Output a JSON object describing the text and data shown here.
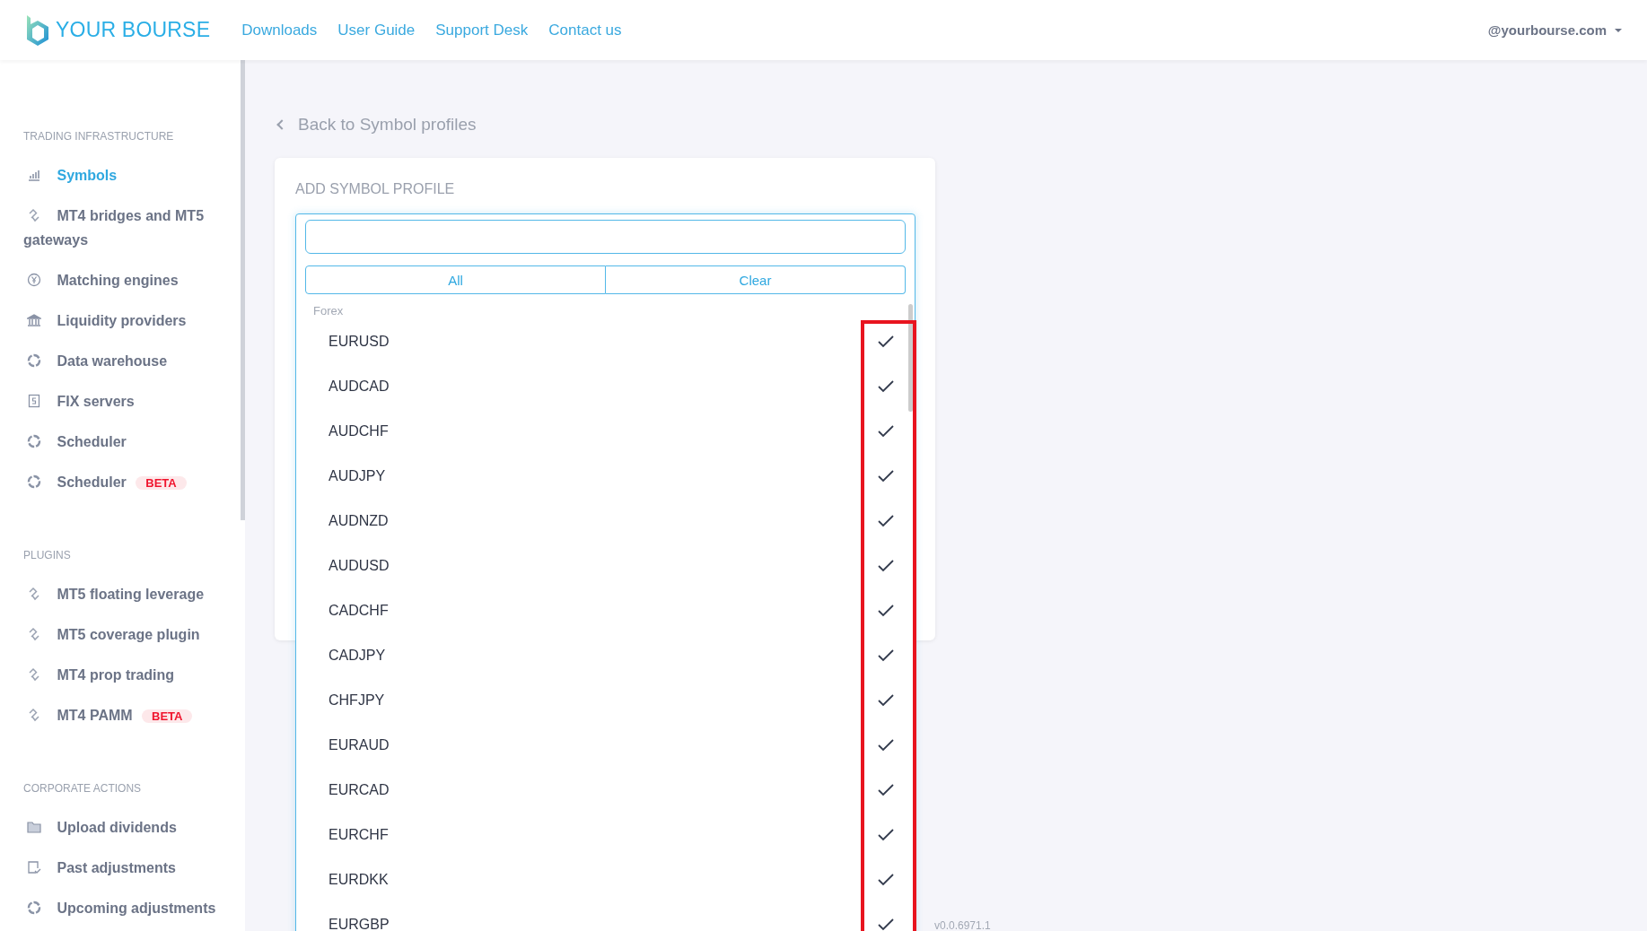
{
  "header": {
    "logo": "YOUR BOURSE",
    "nav": [
      "Downloads",
      "User Guide",
      "Support Desk",
      "Contact us"
    ],
    "user": "@yourbourse.com"
  },
  "sidebar": {
    "sections": [
      {
        "title": "TRADING INFRASTRUCTURE",
        "items": [
          {
            "label": "Symbols",
            "kind": "chart",
            "selected": true
          },
          {
            "label": "MT4 bridges and MT5 gateways",
            "kind": "link",
            "selected": false
          },
          {
            "label": "Matching engines",
            "kind": "yen",
            "selected": false
          },
          {
            "label": "Liquidity providers",
            "kind": "bank",
            "selected": false
          },
          {
            "label": "Data warehouse",
            "kind": "ring",
            "selected": false
          },
          {
            "label": "FIX servers",
            "kind": "doc",
            "selected": false
          },
          {
            "label": "Scheduler",
            "kind": "ring",
            "selected": false
          },
          {
            "label": "Scheduler",
            "kind": "ring",
            "selected": false,
            "badge": "BETA"
          }
        ]
      },
      {
        "title": "PLUGINS",
        "items": [
          {
            "label": "MT5 floating leverage",
            "kind": "link",
            "selected": false
          },
          {
            "label": "MT5 coverage plugin",
            "kind": "link",
            "selected": false
          },
          {
            "label": "MT4 prop trading",
            "kind": "link",
            "selected": false
          },
          {
            "label": "MT4 PAMM",
            "kind": "link",
            "selected": false,
            "badge": "BETA"
          }
        ]
      },
      {
        "title": "CORPORATE ACTIONS",
        "items": [
          {
            "label": "Upload dividends",
            "kind": "folder",
            "selected": false
          },
          {
            "label": "Past adjustments",
            "kind": "check-doc",
            "selected": false
          },
          {
            "label": "Upcoming adjustments",
            "kind": "ring",
            "selected": false
          }
        ]
      }
    ]
  },
  "main": {
    "back_link": "Back to Symbol profiles",
    "card_title": "ADD SYMBOL PROFILE",
    "dropdown": {
      "buttons": [
        "All",
        "Clear"
      ],
      "group": "Forex",
      "options": [
        {
          "label": "EURUSD",
          "checked": true
        },
        {
          "label": "AUDCAD",
          "checked": true
        },
        {
          "label": "AUDCHF",
          "checked": true
        },
        {
          "label": "AUDJPY",
          "checked": true
        },
        {
          "label": "AUDNZD",
          "checked": true
        },
        {
          "label": "AUDUSD",
          "checked": true
        },
        {
          "label": "CADCHF",
          "checked": true
        },
        {
          "label": "CADJPY",
          "checked": true
        },
        {
          "label": "CHFJPY",
          "checked": true
        },
        {
          "label": "EURAUD",
          "checked": true
        },
        {
          "label": "EURCAD",
          "checked": true
        },
        {
          "label": "EURCHF",
          "checked": true
        },
        {
          "label": "EURDKK",
          "checked": true
        },
        {
          "label": "EURGBP",
          "checked": true
        }
      ]
    },
    "version": "v0.0.6971.1"
  }
}
